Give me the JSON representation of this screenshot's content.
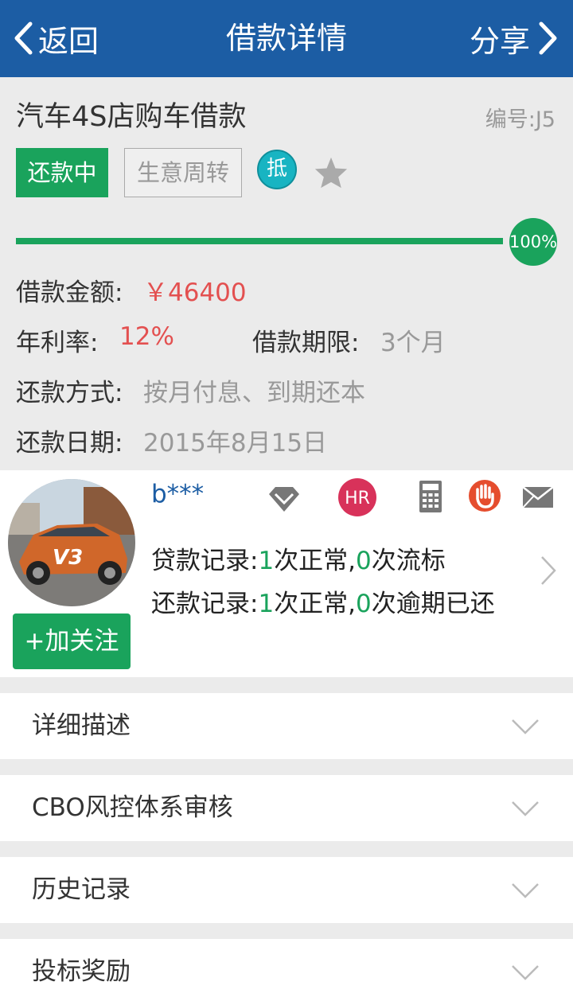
{
  "nav": {
    "back_label": "返回",
    "title": "借款详情",
    "share_label": "分享"
  },
  "loan": {
    "title": "汽车4S店购车借款",
    "number": "编号:J5",
    "status_badge": "还款中",
    "purpose_tag": "生意周转",
    "mortgage_badge": "抵",
    "progress_percent": 100,
    "progress_label": "100%",
    "amount_label": "借款金额:",
    "amount_value": "￥46400",
    "rate_label": "年利率:",
    "rate_value": "12%",
    "term_label": "借款期限:",
    "term_value": "3个月",
    "method_label": "还款方式:",
    "method_value": "按月付息、到期还本",
    "date_label": "还款日期:",
    "date_value": "2015年8月15日"
  },
  "borrower": {
    "avatar_text": "V3",
    "username": "b***",
    "hr_badge": "HR",
    "follow_label": "+加关注",
    "loan_record_prefix": "贷款记录:",
    "loan_normal_count": "1",
    "loan_normal_text": "次正常,",
    "loan_failed_count": "0",
    "loan_failed_text": "次流标",
    "repay_record_prefix": "还款记录:",
    "repay_normal_count": "1",
    "repay_normal_text": "次正常,",
    "repay_overdue_count": "0",
    "repay_overdue_text": "次逾期已还"
  },
  "sections": [
    {
      "label": "详细描述"
    },
    {
      "label": "CBO风控体系审核"
    },
    {
      "label": "历史记录"
    },
    {
      "label": "投标奖励"
    }
  ],
  "colors": {
    "nav_bg": "#1c5da4",
    "green": "#1aa35c",
    "red": "#e35050",
    "grey_text": "#999999"
  }
}
